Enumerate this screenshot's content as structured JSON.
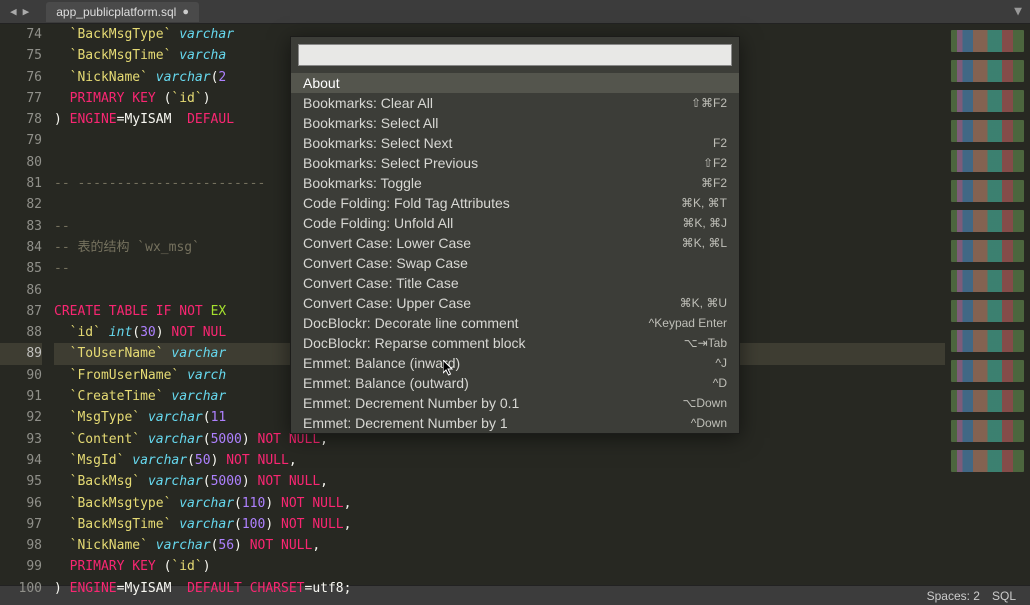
{
  "tab": {
    "filename": "app_publicplatform.sql",
    "dirty": true
  },
  "statusbar": {
    "spaces": "Spaces: 2",
    "lang": "SQL"
  },
  "gutter": {
    "start": 74,
    "end": 100,
    "active": 89
  },
  "code_lines": [
    {
      "n": 74,
      "tokens": [
        [
          "pun",
          "  "
        ],
        [
          "str",
          "`BackMsgType`"
        ],
        [
          "pun",
          " "
        ],
        [
          "type",
          "varchar"
        ]
      ]
    },
    {
      "n": 75,
      "tokens": [
        [
          "pun",
          "  "
        ],
        [
          "str",
          "`BackMsgTime`"
        ],
        [
          "pun",
          " "
        ],
        [
          "type",
          "varcha"
        ]
      ]
    },
    {
      "n": 76,
      "tokens": [
        [
          "pun",
          "  "
        ],
        [
          "str",
          "`NickName`"
        ],
        [
          "pun",
          " "
        ],
        [
          "type",
          "varchar"
        ],
        [
          "pun",
          "("
        ],
        [
          "num",
          "2"
        ]
      ]
    },
    {
      "n": 77,
      "tokens": [
        [
          "pun",
          "  "
        ],
        [
          "kw",
          "PRIMARY KEY"
        ],
        [
          "pun",
          " ("
        ],
        [
          "str",
          "`id`"
        ],
        [
          "pun",
          ")"
        ]
      ]
    },
    {
      "n": 78,
      "tokens": [
        [
          "pun",
          ") "
        ],
        [
          "kw",
          "ENGINE"
        ],
        [
          "pun",
          "="
        ],
        [
          "pun",
          "MyISAM  "
        ],
        [
          "kw",
          "DEFAUL"
        ]
      ]
    },
    {
      "n": 79,
      "tokens": []
    },
    {
      "n": 80,
      "tokens": []
    },
    {
      "n": 81,
      "tokens": [
        [
          "cm",
          "-- ------------------------"
        ]
      ]
    },
    {
      "n": 82,
      "tokens": []
    },
    {
      "n": 83,
      "tokens": [
        [
          "cm",
          "--"
        ]
      ]
    },
    {
      "n": 84,
      "tokens": [
        [
          "cm",
          "-- 表的结构 `wx_msg`"
        ]
      ]
    },
    {
      "n": 85,
      "tokens": [
        [
          "cm",
          "--"
        ]
      ]
    },
    {
      "n": 86,
      "tokens": []
    },
    {
      "n": 87,
      "tokens": [
        [
          "kw",
          "CREATE"
        ],
        [
          "pun",
          " "
        ],
        [
          "kw",
          "TABLE"
        ],
        [
          "pun",
          " "
        ],
        [
          "kw",
          "IF"
        ],
        [
          "pun",
          " "
        ],
        [
          "kw",
          "NOT"
        ],
        [
          "pun",
          " "
        ],
        [
          "fn",
          "EX"
        ]
      ]
    },
    {
      "n": 88,
      "tokens": [
        [
          "pun",
          "  "
        ],
        [
          "str",
          "`id`"
        ],
        [
          "pun",
          " "
        ],
        [
          "type",
          "int"
        ],
        [
          "pun",
          "("
        ],
        [
          "num",
          "30"
        ],
        [
          "pun",
          ") "
        ],
        [
          "kw",
          "NOT"
        ],
        [
          "pun",
          " "
        ],
        [
          "kw",
          "NUL"
        ]
      ]
    },
    {
      "n": 89,
      "tokens": [
        [
          "pun",
          "  "
        ],
        [
          "str",
          "`ToUserName`"
        ],
        [
          "pun",
          " "
        ],
        [
          "type",
          "varchar"
        ]
      ]
    },
    {
      "n": 90,
      "tokens": [
        [
          "pun",
          "  "
        ],
        [
          "str",
          "`FromUserName`"
        ],
        [
          "pun",
          " "
        ],
        [
          "type",
          "varch"
        ]
      ]
    },
    {
      "n": 91,
      "tokens": [
        [
          "pun",
          "  "
        ],
        [
          "str",
          "`CreateTime`"
        ],
        [
          "pun",
          " "
        ],
        [
          "type",
          "varchar"
        ]
      ]
    },
    {
      "n": 92,
      "tokens": [
        [
          "pun",
          "  "
        ],
        [
          "str",
          "`MsgType`"
        ],
        [
          "pun",
          " "
        ],
        [
          "type",
          "varchar"
        ],
        [
          "pun",
          "("
        ],
        [
          "num",
          "11"
        ]
      ]
    },
    {
      "n": 93,
      "tokens": [
        [
          "pun",
          "  "
        ],
        [
          "str",
          "`Content`"
        ],
        [
          "pun",
          " "
        ],
        [
          "type",
          "varchar"
        ],
        [
          "pun",
          "("
        ],
        [
          "num",
          "5000"
        ],
        [
          "pun",
          ") "
        ],
        [
          "kw",
          "NOT"
        ],
        [
          "pun",
          " "
        ],
        [
          "kw",
          "NULL"
        ],
        [
          "pun",
          ","
        ]
      ]
    },
    {
      "n": 94,
      "tokens": [
        [
          "pun",
          "  "
        ],
        [
          "str",
          "`MsgId`"
        ],
        [
          "pun",
          " "
        ],
        [
          "type",
          "varchar"
        ],
        [
          "pun",
          "("
        ],
        [
          "num",
          "50"
        ],
        [
          "pun",
          ") "
        ],
        [
          "kw",
          "NOT"
        ],
        [
          "pun",
          " "
        ],
        [
          "kw",
          "NULL"
        ],
        [
          "pun",
          ","
        ]
      ]
    },
    {
      "n": 95,
      "tokens": [
        [
          "pun",
          "  "
        ],
        [
          "str",
          "`BackMsg`"
        ],
        [
          "pun",
          " "
        ],
        [
          "type",
          "varchar"
        ],
        [
          "pun",
          "("
        ],
        [
          "num",
          "5000"
        ],
        [
          "pun",
          ") "
        ],
        [
          "kw",
          "NOT"
        ],
        [
          "pun",
          " "
        ],
        [
          "kw",
          "NULL"
        ],
        [
          "pun",
          ","
        ]
      ]
    },
    {
      "n": 96,
      "tokens": [
        [
          "pun",
          "  "
        ],
        [
          "str",
          "`BackMsgtype`"
        ],
        [
          "pun",
          " "
        ],
        [
          "type",
          "varchar"
        ],
        [
          "pun",
          "("
        ],
        [
          "num",
          "110"
        ],
        [
          "pun",
          ") "
        ],
        [
          "kw",
          "NOT"
        ],
        [
          "pun",
          " "
        ],
        [
          "kw",
          "NULL"
        ],
        [
          "pun",
          ","
        ]
      ]
    },
    {
      "n": 97,
      "tokens": [
        [
          "pun",
          "  "
        ],
        [
          "str",
          "`BackMsgTime`"
        ],
        [
          "pun",
          " "
        ],
        [
          "type",
          "varchar"
        ],
        [
          "pun",
          "("
        ],
        [
          "num",
          "100"
        ],
        [
          "pun",
          ") "
        ],
        [
          "kw",
          "NOT"
        ],
        [
          "pun",
          " "
        ],
        [
          "kw",
          "NULL"
        ],
        [
          "pun",
          ","
        ]
      ]
    },
    {
      "n": 98,
      "tokens": [
        [
          "pun",
          "  "
        ],
        [
          "str",
          "`NickName`"
        ],
        [
          "pun",
          " "
        ],
        [
          "type",
          "varchar"
        ],
        [
          "pun",
          "("
        ],
        [
          "num",
          "56"
        ],
        [
          "pun",
          ") "
        ],
        [
          "kw",
          "NOT"
        ],
        [
          "pun",
          " "
        ],
        [
          "kw",
          "NULL"
        ],
        [
          "pun",
          ","
        ]
      ]
    },
    {
      "n": 99,
      "tokens": [
        [
          "pun",
          "  "
        ],
        [
          "kw",
          "PRIMARY KEY"
        ],
        [
          "pun",
          " ("
        ],
        [
          "str",
          "`id`"
        ],
        [
          "pun",
          ")"
        ]
      ]
    },
    {
      "n": 100,
      "tokens": [
        [
          "pun",
          ") "
        ],
        [
          "kw",
          "ENGINE"
        ],
        [
          "pun",
          "="
        ],
        [
          "pun",
          "MyISAM  "
        ],
        [
          "kw",
          "DEFAULT"
        ],
        [
          "pun",
          " "
        ],
        [
          "kw",
          "CHARSET"
        ],
        [
          "pun",
          "="
        ],
        [
          "pun",
          "utf8;"
        ]
      ]
    }
  ],
  "palette": {
    "selected_index": 0,
    "items": [
      {
        "label": "About",
        "shortcut": ""
      },
      {
        "label": "Bookmarks: Clear All",
        "shortcut": "⇧⌘F2"
      },
      {
        "label": "Bookmarks: Select All",
        "shortcut": ""
      },
      {
        "label": "Bookmarks: Select Next",
        "shortcut": "F2"
      },
      {
        "label": "Bookmarks: Select Previous",
        "shortcut": "⇧F2"
      },
      {
        "label": "Bookmarks: Toggle",
        "shortcut": "⌘F2"
      },
      {
        "label": "Code Folding: Fold Tag Attributes",
        "shortcut": "⌘K, ⌘T"
      },
      {
        "label": "Code Folding: Unfold All",
        "shortcut": "⌘K, ⌘J"
      },
      {
        "label": "Convert Case: Lower Case",
        "shortcut": "⌘K, ⌘L"
      },
      {
        "label": "Convert Case: Swap Case",
        "shortcut": ""
      },
      {
        "label": "Convert Case: Title Case",
        "shortcut": ""
      },
      {
        "label": "Convert Case: Upper Case",
        "shortcut": "⌘K, ⌘U"
      },
      {
        "label": "DocBlockr: Decorate line comment",
        "shortcut": "^Keypad Enter"
      },
      {
        "label": "DocBlockr: Reparse comment block",
        "shortcut": "⌥⇥Tab"
      },
      {
        "label": "Emmet: Balance (inward)",
        "shortcut": "^J"
      },
      {
        "label": "Emmet: Balance (outward)",
        "shortcut": "^D"
      },
      {
        "label": "Emmet: Decrement Number by 0.1",
        "shortcut": "⌥Down"
      },
      {
        "label": "Emmet: Decrement Number by 1",
        "shortcut": "^Down"
      }
    ]
  }
}
